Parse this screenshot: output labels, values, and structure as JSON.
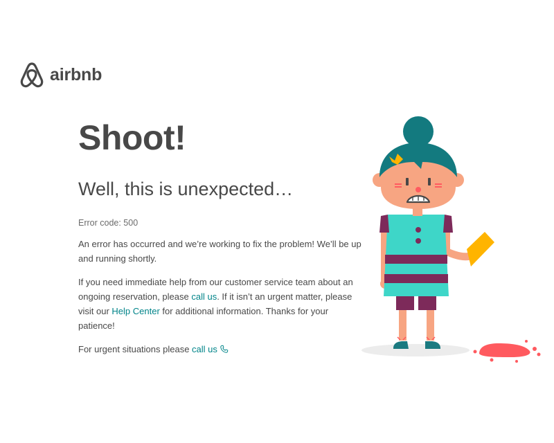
{
  "brand": {
    "wordmark": "airbnb",
    "logo_icon": "airbnb-belo-icon"
  },
  "error_page": {
    "headline": "Shoot!",
    "subheadline": "Well, this is unexpected…",
    "error_code": "Error code: 500",
    "paragraph_1": "An error has occurred and we’re working to fix the problem! We’ll be up and running shortly.",
    "paragraph_2": {
      "part_1": "If you need immediate help from our customer service team about an ongoing reservation, please ",
      "link_call_us": "call us",
      "part_2": ". If it isn’t an urgent matter, please visit our ",
      "link_help_center": "Help Center",
      "part_3": " for additional information. Thanks for your patience!"
    },
    "urgent": {
      "text": "For urgent situations please ",
      "link_call_us": "call us",
      "icon": "phone-icon"
    }
  },
  "illustration": {
    "name": "girl-dropped-ice-cream",
    "colors": {
      "hair": "#137a7f",
      "skin": "#f7a582",
      "dress": "#3ed6c8",
      "stripes": "#7d2a5a",
      "cone": "#ffb400",
      "ice_cream": "#ff5a5f",
      "shadow": "#ececec",
      "shoes": "#1b7a80"
    }
  },
  "theme": {
    "text": "#484848",
    "link": "#008489"
  }
}
